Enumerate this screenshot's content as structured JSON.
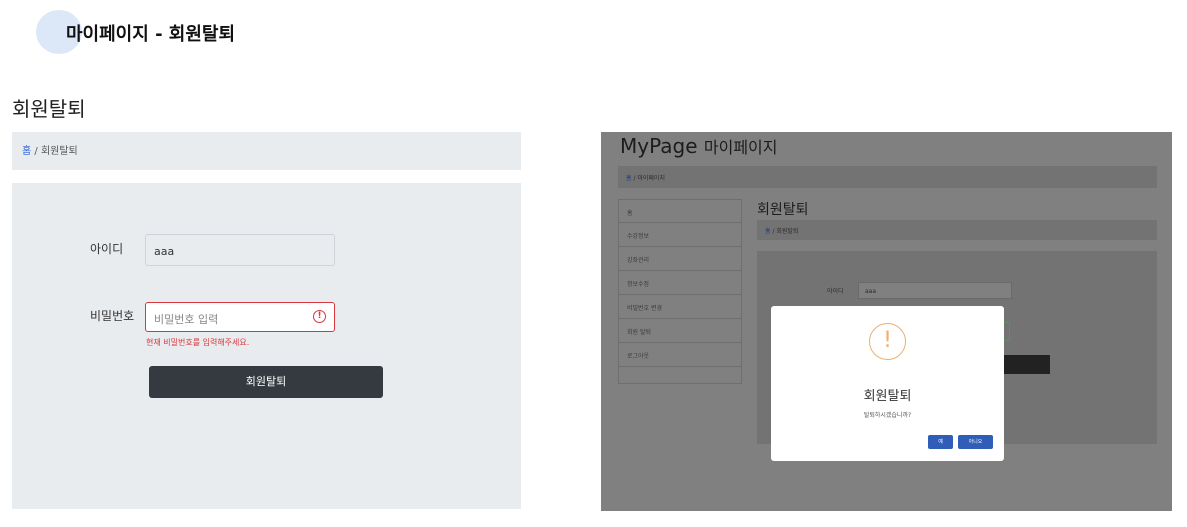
{
  "slide": {
    "title": "마이페이지 - 회원탈퇴"
  },
  "left": {
    "title": "회원탈퇴",
    "breadcrumb": {
      "home": "홈",
      "sep": " / ",
      "current": "회원탈퇴"
    },
    "form": {
      "id_label": "아이디",
      "id_value": "aaa",
      "pw_label": "비밀번호",
      "pw_placeholder": "비밀번호 입력",
      "pw_error": "현재 비밀번호를 입력해주세요.",
      "submit": "회원탈퇴"
    }
  },
  "right": {
    "title": "MyPage",
    "title_sub": "마이페이지",
    "breadcrumb": {
      "home": "홈",
      "sep": " / ",
      "current": "마이페이지"
    },
    "sidebar": [
      "홈",
      "수강정보",
      "강좌관리",
      "정보수정",
      "비밀번호 변경",
      "회원 탈퇴",
      "로그아웃"
    ],
    "section_title": "회원탈퇴",
    "section_breadcrumb": {
      "home": "홈",
      "sep": " / ",
      "current": "회원탈퇴"
    },
    "form": {
      "id_label": "아이디",
      "id_value": "aaa"
    },
    "modal": {
      "icon": "!",
      "title": "회원탈퇴",
      "text": "탈퇴하시겠습니까?",
      "yes": "예",
      "no": "아니오"
    }
  }
}
